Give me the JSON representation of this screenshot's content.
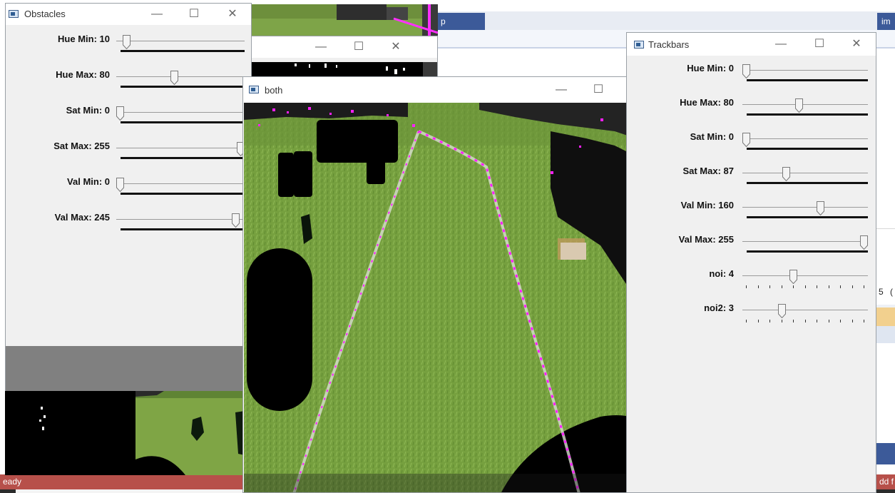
{
  "ide": {
    "tab1_label": "p",
    "tab2_label": "im",
    "status_left": "eady",
    "status_right": "dd f",
    "right_glyphs": [
      "5",
      "("
    ]
  },
  "windows": {
    "obstacles": {
      "title": "Obstacles",
      "trackbars": [
        {
          "label": "Hue Min: 10",
          "value": 10,
          "max": 179
        },
        {
          "label": "Hue Max: 80",
          "value": 80,
          "max": 179
        },
        {
          "label": "Sat Min: 0",
          "value": 0,
          "max": 255
        },
        {
          "label": "Sat Max: 255",
          "value": 255,
          "max": 255
        },
        {
          "label": "Val Min: 0",
          "value": 0,
          "max": 255
        },
        {
          "label": "Val Max: 245",
          "value": 245,
          "max": 255
        }
      ]
    },
    "both": {
      "title": "both"
    },
    "untitled": {
      "title": ""
    },
    "trackbars": {
      "title": "Trackbars",
      "trackbars": [
        {
          "label": "Hue Min: 0",
          "value": 0,
          "max": 179
        },
        {
          "label": "Hue Max: 80",
          "value": 80,
          "max": 179
        },
        {
          "label": "Sat Min: 0",
          "value": 0,
          "max": 255
        },
        {
          "label": "Sat Max: 87",
          "value": 87,
          "max": 255
        },
        {
          "label": "Val Min: 160",
          "value": 160,
          "max": 255
        },
        {
          "label": "Val Max: 255",
          "value": 255,
          "max": 255
        },
        {
          "label": "noi: 4",
          "value": 4,
          "max": 10
        },
        {
          "label": "noi2: 3",
          "value": 3,
          "max": 10
        }
      ]
    }
  },
  "window_controls": {
    "minimize": "—",
    "maximize": "☐",
    "close": "✕"
  },
  "colors": {
    "grass": "#6f9a3a",
    "grass_light": "#8db34d",
    "mask_black": "#000000",
    "highlight": "#ff1fff",
    "status_bar": "#b7504a",
    "ide_tab": "#3c5a99"
  }
}
